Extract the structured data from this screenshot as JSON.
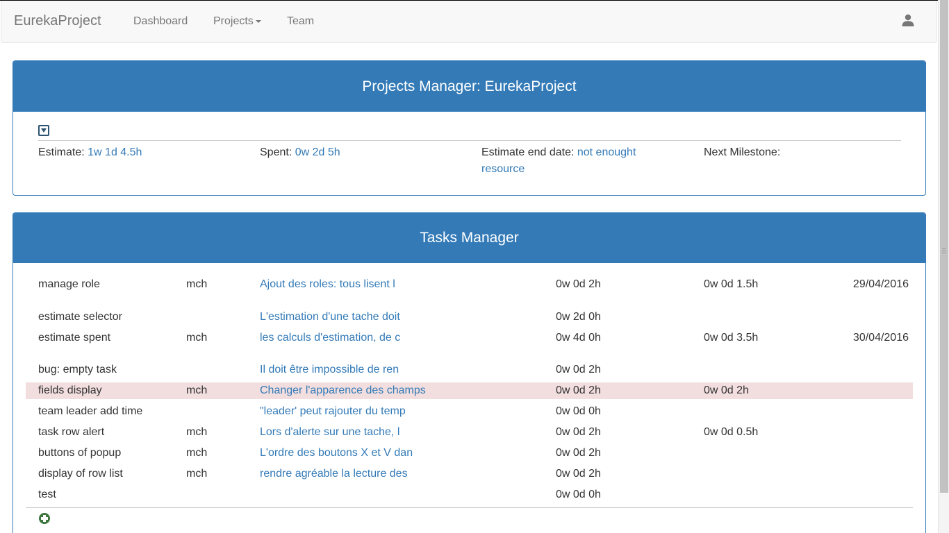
{
  "navbar": {
    "brand": "EurekaProject",
    "items": [
      {
        "label": "Dashboard"
      },
      {
        "label": "Projects"
      },
      {
        "label": "Team"
      }
    ],
    "user_icon": "user-icon"
  },
  "projects_panel": {
    "title": "Projects Manager: EurekaProject",
    "toggle_icon": "collapse-toggle-icon",
    "estimate": {
      "label": "Estimate: ",
      "value": "1w 1d 4.5h"
    },
    "spent": {
      "label": "Spent: ",
      "value": "0w 2d 5h"
    },
    "end_date": {
      "label": "Estimate end date: ",
      "value": "not enought resource"
    },
    "milestone": {
      "label": "Next Milestone:",
      "value": ""
    }
  },
  "tasks_panel": {
    "title": "Tasks Manager",
    "add_icon": "add-circle-icon",
    "tasks": [
      {
        "name": "manage role",
        "user": "mch",
        "desc": "Ajout des roles: tous lisent l",
        "estimate": "0w 0d 2h",
        "spent": "0w 0d 1.5h",
        "date": "29/04/2016",
        "alert": false
      },
      {
        "name": "estimate selector",
        "user": "",
        "desc": "L'estimation d'une tache doit",
        "estimate": "0w 2d 0h",
        "spent": "",
        "date": "",
        "alert": false
      },
      {
        "name": "estimate spent",
        "user": "mch",
        "desc": "les calculs d'estimation, de c",
        "estimate": "0w 4d 0h",
        "spent": "0w 0d 3.5h",
        "date": "30/04/2016",
        "alert": false
      },
      {
        "name": "bug: empty task",
        "user": "",
        "desc": "Il doit être impossible de ren",
        "estimate": "0w 0d 2h",
        "spent": "",
        "date": "",
        "alert": false
      },
      {
        "name": "fields display",
        "user": "mch",
        "desc": "Changer l'apparence des champs",
        "estimate": "0w 0d 2h",
        "spent": "0w 0d 2h",
        "date": "",
        "alert": true
      },
      {
        "name": "team leader add time",
        "user": "",
        "desc": "\"leader' peut rajouter du temp",
        "estimate": "0w 0d 0h",
        "spent": "",
        "date": "",
        "alert": false
      },
      {
        "name": "task row alert",
        "user": "mch",
        "desc": "Lors d'alerte sur une tache, l",
        "estimate": "0w 0d 2h",
        "spent": "0w 0d 0.5h",
        "date": "",
        "alert": false
      },
      {
        "name": "buttons of popup",
        "user": "mch",
        "desc": "L'ordre des boutons X et V dan",
        "estimate": "0w 0d 2h",
        "spent": "",
        "date": "",
        "alert": false
      },
      {
        "name": "display of row list",
        "user": "mch",
        "desc": "rendre agréable la lecture des",
        "estimate": "0w 0d 2h",
        "spent": "",
        "date": "",
        "alert": false
      },
      {
        "name": "test",
        "user": "",
        "desc": "",
        "estimate": "0w 0d 0h",
        "spent": "",
        "date": "",
        "alert": false
      }
    ]
  },
  "colors": {
    "primary": "#337ab7",
    "alert_row": "#f2dede",
    "add_button": "#3c763d"
  }
}
